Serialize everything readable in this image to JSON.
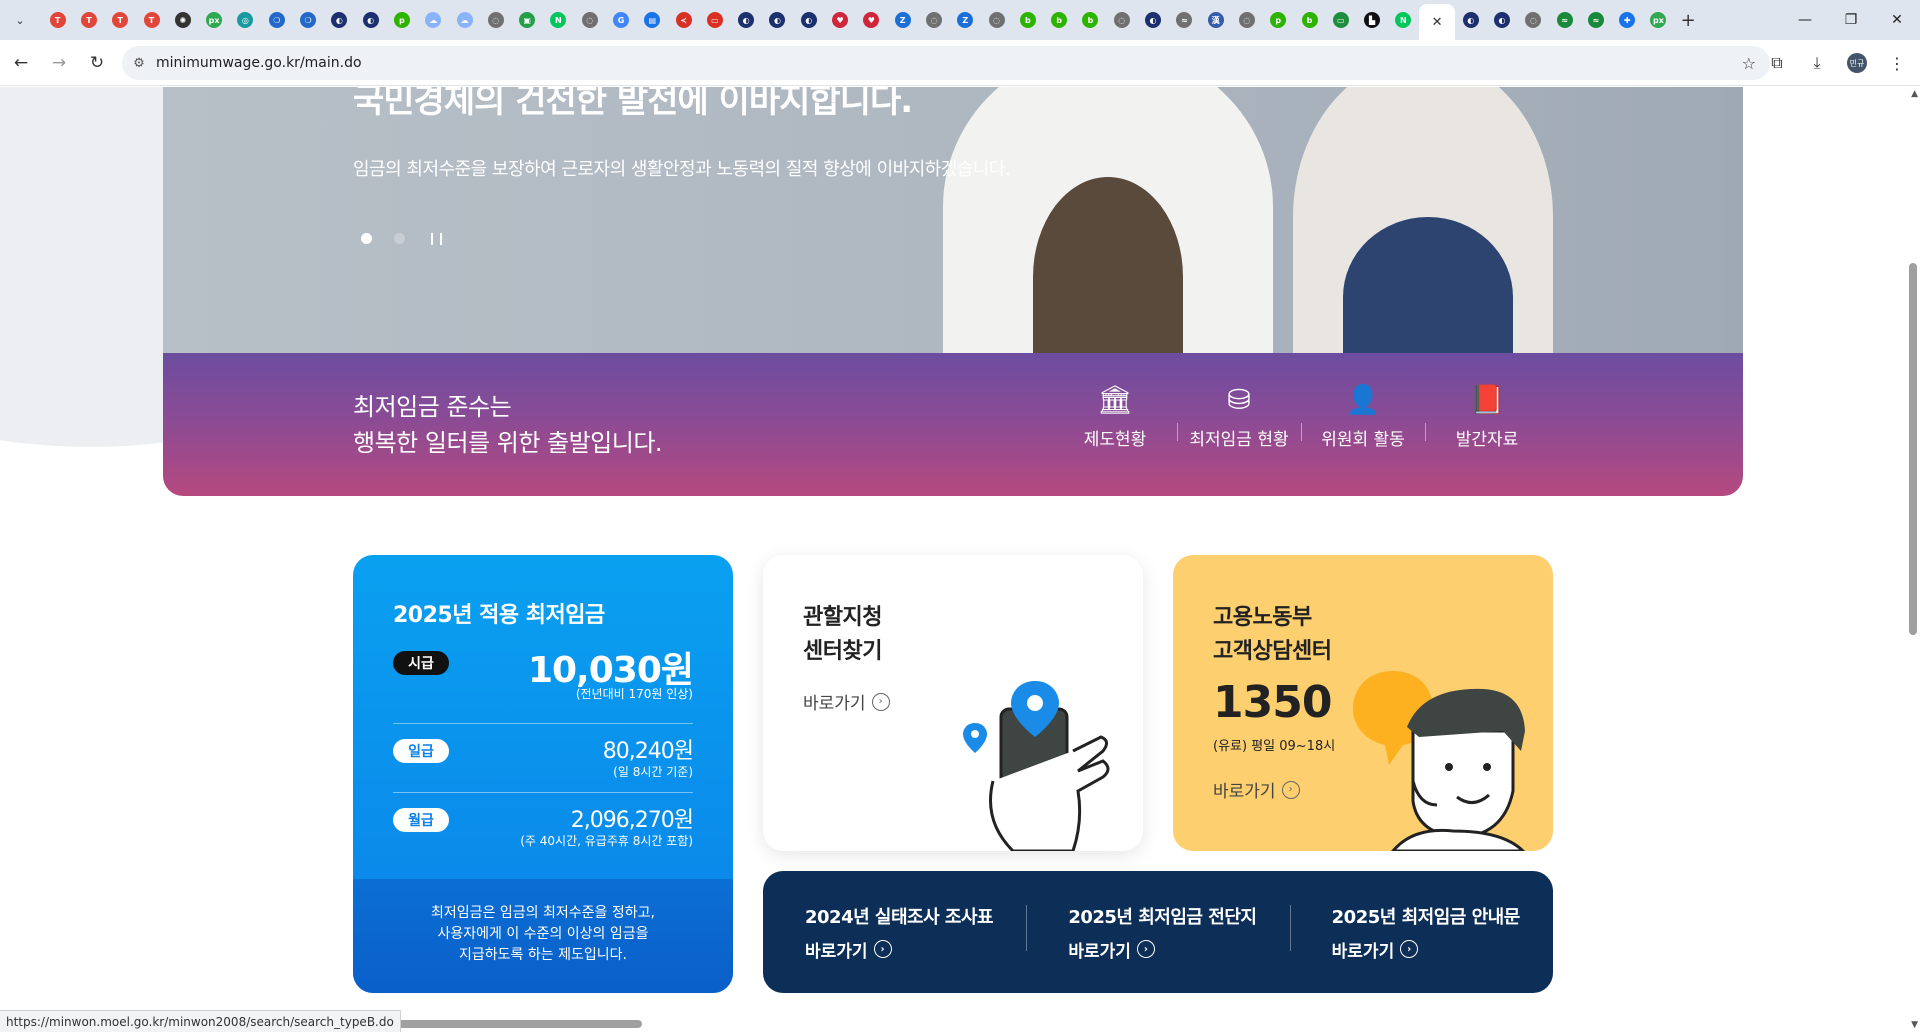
{
  "browser": {
    "url": "minimumwage.go.kr/main.do",
    "profile_initials": "민규",
    "tab_favicons": [
      {
        "icon": "red-circle-icon",
        "color": "#e0463a",
        "glyph": "T"
      },
      {
        "icon": "red-circle-icon",
        "color": "#e0463a",
        "glyph": "T"
      },
      {
        "icon": "red-circle-icon",
        "color": "#e0463a",
        "glyph": "T"
      },
      {
        "icon": "red-circle-icon",
        "color": "#e0463a",
        "glyph": "T"
      },
      {
        "icon": "openai-icon",
        "color": "#333333",
        "glyph": "✺"
      },
      {
        "icon": "px-icon",
        "color": "#2fa84f",
        "glyph": "px"
      },
      {
        "icon": "teal-icon",
        "color": "#1a9aa0",
        "glyph": "◎"
      },
      {
        "icon": "blue-swirl-icon",
        "color": "#2469c9",
        "glyph": "❍"
      },
      {
        "icon": "blue-swirl-icon",
        "color": "#2469c9",
        "glyph": "❍"
      },
      {
        "icon": "gov-icon",
        "color": "#1c2f6e",
        "glyph": "◐"
      },
      {
        "icon": "gov-icon",
        "color": "#1c2f6e",
        "glyph": "◐"
      },
      {
        "icon": "pay-icon",
        "color": "#2db400",
        "glyph": "p"
      },
      {
        "icon": "cloud-icon",
        "color": "#8ab4f8",
        "glyph": "☁"
      },
      {
        "icon": "cloud-icon",
        "color": "#8ab4f8",
        "glyph": "☁"
      },
      {
        "icon": "globe-icon",
        "color": "#707070",
        "glyph": "◌"
      },
      {
        "icon": "green-square-icon",
        "color": "#24a148",
        "glyph": "▣"
      },
      {
        "icon": "naver-icon",
        "color": "#03c75a",
        "glyph": "N"
      },
      {
        "icon": "globe-icon",
        "color": "#707070",
        "glyph": "◌"
      },
      {
        "icon": "google-icon",
        "color": "#4285f4",
        "glyph": "G"
      },
      {
        "icon": "image-icon",
        "color": "#1a73e8",
        "glyph": "▤"
      },
      {
        "icon": "sbs-icon",
        "color": "#d93025",
        "glyph": "≺"
      },
      {
        "icon": "kbs-icon",
        "color": "#d93025",
        "glyph": "▭"
      },
      {
        "icon": "gov-icon",
        "color": "#1c2f6e",
        "glyph": "◐"
      },
      {
        "icon": "gov-icon",
        "color": "#1c2f6e",
        "glyph": "◐"
      },
      {
        "icon": "gov-icon",
        "color": "#1c2f6e",
        "glyph": "◐"
      },
      {
        "icon": "red-heart-icon",
        "color": "#d0263b",
        "glyph": "♥"
      },
      {
        "icon": "red-heart-icon",
        "color": "#d0263b",
        "glyph": "♥"
      },
      {
        "icon": "blue-z-icon",
        "color": "#1d6fd6",
        "glyph": "Z"
      },
      {
        "icon": "globe-icon",
        "color": "#707070",
        "glyph": "◌"
      },
      {
        "icon": "blue-z-icon",
        "color": "#1d6fd6",
        "glyph": "Z"
      },
      {
        "icon": "globe-icon",
        "color": "#707070",
        "glyph": "◌"
      },
      {
        "icon": "green-blog-icon",
        "color": "#2db400",
        "glyph": "b"
      },
      {
        "icon": "green-blog-icon",
        "color": "#2db400",
        "glyph": "b"
      },
      {
        "icon": "green-blog-icon",
        "color": "#2db400",
        "glyph": "b"
      },
      {
        "icon": "globe-icon",
        "color": "#707070",
        "glyph": "◌"
      },
      {
        "icon": "gov-icon",
        "color": "#1c2f6e",
        "glyph": "◐"
      },
      {
        "icon": "wifi-icon",
        "color": "#707070",
        "glyph": "≈"
      },
      {
        "icon": "hanja-icon",
        "color": "#345ca8",
        "glyph": "漢"
      },
      {
        "icon": "globe-icon",
        "color": "#707070",
        "glyph": "◌"
      },
      {
        "icon": "pay-icon",
        "color": "#2db400",
        "glyph": "p"
      },
      {
        "icon": "green-blog-icon",
        "color": "#2db400",
        "glyph": "b"
      },
      {
        "icon": "monitor-icon",
        "color": "#1e8e3e",
        "glyph": "▭"
      },
      {
        "icon": "black-bag-icon",
        "color": "#111111",
        "glyph": "▙"
      },
      {
        "icon": "naver-icon",
        "color": "#03c75a",
        "glyph": "N"
      },
      {
        "icon": "close-icon",
        "color": "#333333",
        "glyph": "✕",
        "active": true
      },
      {
        "icon": "gov-icon",
        "color": "#1c2f6e",
        "glyph": "◐"
      },
      {
        "icon": "gov-icon",
        "color": "#1c2f6e",
        "glyph": "◐"
      },
      {
        "icon": "globe-icon",
        "color": "#707070",
        "glyph": "◌"
      },
      {
        "icon": "wave-icon",
        "color": "#1a8a3a",
        "glyph": "≈"
      },
      {
        "icon": "wave-icon",
        "color": "#1a8a3a",
        "glyph": "≈"
      },
      {
        "icon": "plus-cross-icon",
        "color": "#1a73e8",
        "glyph": "✚"
      },
      {
        "icon": "px-icon",
        "color": "#2fa84f",
        "glyph": "px"
      }
    ],
    "status_url": "https://minwon.moel.go.kr/minwon2008/search/search_typeB.do"
  },
  "hero": {
    "title": "국민경제의 건전한 발전에 이바지합니다.",
    "subtitle": "임금의 최저수준을 보장하여 근로자의 생활안정과 노동력의 질적 향상에 이바지하겠습니다."
  },
  "band": {
    "line1": "최저임금 준수는",
    "line2": "행복한 일터를 위한 출발입니다.",
    "menu": [
      {
        "label": "제도현황",
        "icon": "bank-icon",
        "glyph": "🏛"
      },
      {
        "label": "최저임금 현황",
        "icon": "coins-icon",
        "glyph": "⛁"
      },
      {
        "label": "위원회 활동",
        "icon": "person-icon",
        "glyph": "👤"
      },
      {
        "label": "발간자료",
        "icon": "book-icon",
        "glyph": "📕"
      }
    ]
  },
  "wage": {
    "title": "2025년 적용 최저임금",
    "hourly_label": "시급",
    "hourly": "10,030원",
    "hourly_note": "(전년대비 170원 인상)",
    "daily_label": "일급",
    "daily": "80,240원",
    "daily_note": "(일 8시간 기준)",
    "monthly_label": "월급",
    "monthly": "2,096,270원",
    "monthly_note": "(주 40시간, 유급주휴 8시간 포함)",
    "desc1": "최저임금은 임금의 최저수준을 정하고,",
    "desc2": "사용자에게 이 수준의 이상의 임금을",
    "desc3": "지급하도록 하는 제도입니다."
  },
  "center_card": {
    "line1": "관할지청",
    "line2": "센터찾기",
    "link": "바로가기"
  },
  "call_card": {
    "line1": "고용노동부",
    "line2": "고객상담센터",
    "number": "1350",
    "hours": "(유료) 평일 09~18시",
    "link": "바로가기"
  },
  "downloads": [
    {
      "title": "2024년 실태조사 조사표",
      "link": "바로가기"
    },
    {
      "title": "2025년 최저임금 전단지",
      "link": "바로가기"
    },
    {
      "title": "2025년 최저임금 안내문",
      "link": "바로가기"
    }
  ]
}
